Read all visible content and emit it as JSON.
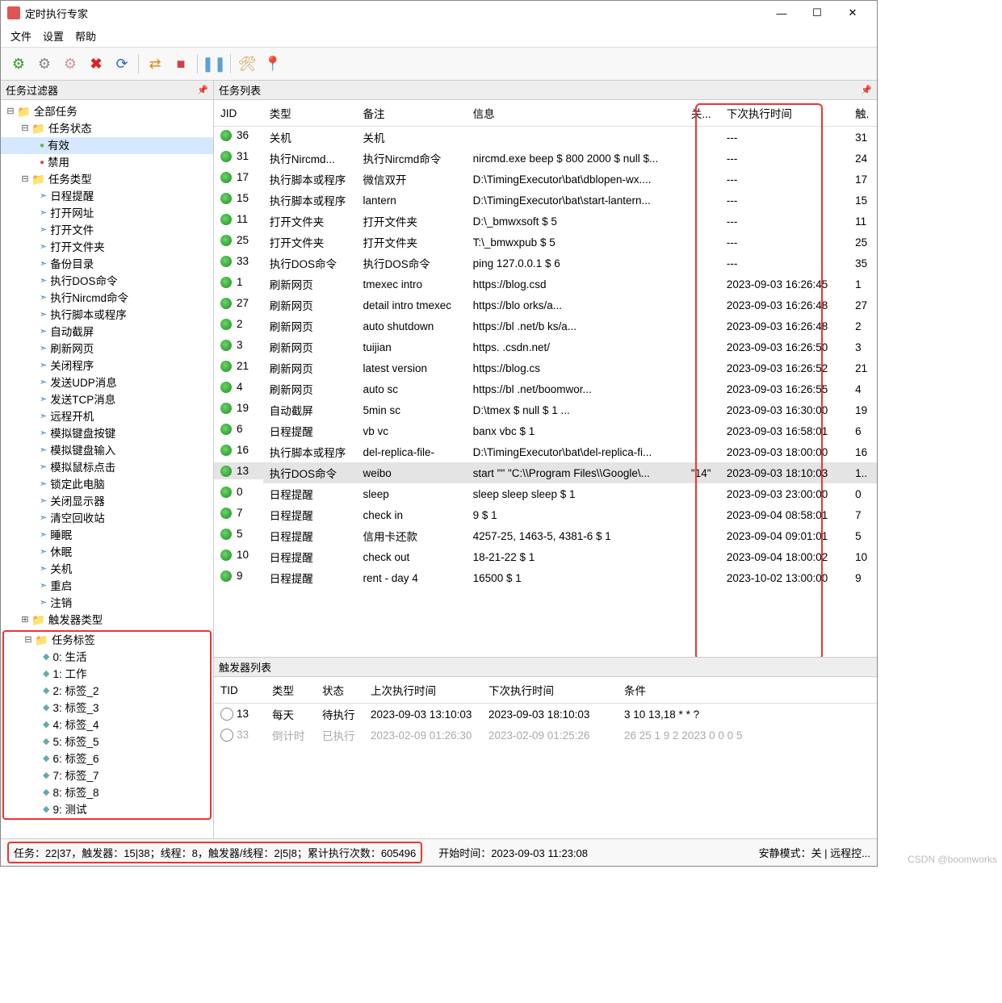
{
  "window": {
    "title": "定时执行专家"
  },
  "menubar": [
    "文件",
    "设置",
    "帮助"
  ],
  "sidebar": {
    "header": "任务过滤器",
    "root": "全部任务",
    "status": {
      "label": "任务状态",
      "items": [
        "有效",
        "禁用"
      ]
    },
    "taskTypes": {
      "label": "任务类型",
      "items": [
        "日程提醒",
        "打开网址",
        "打开文件",
        "打开文件夹",
        "备份目录",
        "执行DOS命令",
        "执行Nircmd命令",
        "执行脚本或程序",
        "自动截屏",
        "刷新网页",
        "关闭程序",
        "发送UDP消息",
        "发送TCP消息",
        "远程开机",
        "模拟键盘按键",
        "模拟键盘输入",
        "模拟鼠标点击",
        "锁定此电脑",
        "关闭显示器",
        "清空回收站",
        "睡眠",
        "休眠",
        "关机",
        "重启",
        "注销"
      ]
    },
    "triggerTypes": {
      "label": "触发器类型"
    },
    "tags": {
      "label": "任务标签",
      "items": [
        "0: 生活",
        "1: 工作",
        "2: 标签_2",
        "3: 标签_3",
        "4: 标签_4",
        "5: 标签_5",
        "6: 标签_6",
        "7: 标签_7",
        "8: 标签_8",
        "9: 测试"
      ]
    }
  },
  "taskList": {
    "header": "任务列表",
    "columns": [
      "JID",
      "类型",
      "备注",
      "信息",
      "关...",
      "下次执行时间",
      "触."
    ],
    "rows": [
      {
        "jid": "36",
        "type": "关机",
        "note": "关机",
        "info": "",
        "kw": "",
        "next": "---",
        "trg": "31"
      },
      {
        "jid": "31",
        "type": "执行Nircmd...",
        "note": "执行Nircmd命令",
        "info": "nircmd.exe beep $ 800 2000 $ null $...",
        "kw": "",
        "next": "---",
        "trg": "24"
      },
      {
        "jid": "17",
        "type": "执行脚本或程序",
        "note": "微信双开",
        "info": "D:\\TimingExecutor\\bat\\dblopen-wx....",
        "kw": "",
        "next": "---",
        "trg": "17"
      },
      {
        "jid": "15",
        "type": "执行脚本或程序",
        "note": "lantern",
        "info": "D:\\TimingExecutor\\bat\\start-lantern...",
        "kw": "",
        "next": "---",
        "trg": "15"
      },
      {
        "jid": "11",
        "type": "打开文件夹",
        "note": "打开文件夹",
        "info": "D:\\_bmwxsoft $ 5",
        "kw": "",
        "next": "---",
        "trg": "11"
      },
      {
        "jid": "25",
        "type": "打开文件夹",
        "note": "打开文件夹",
        "info": "T:\\_bmwxpub $ 5",
        "kw": "",
        "next": "---",
        "trg": "25"
      },
      {
        "jid": "33",
        "type": "执行DOS命令",
        "note": "执行DOS命令",
        "info": "ping 127.0.0.1 $ 6",
        "kw": "",
        "next": "---",
        "trg": "35"
      },
      {
        "jid": "1",
        "type": "刷新网页",
        "note": "tmexec intro",
        "info": "https://blog.csd",
        "kw": "",
        "next": "2023-09-03 16:26:45",
        "trg": "1"
      },
      {
        "jid": "27",
        "type": "刷新网页",
        "note": "detail intro tmexec",
        "info": "https://blo                         orks/a...",
        "kw": "",
        "next": "2023-09-03 16:26:48",
        "trg": "27"
      },
      {
        "jid": "2",
        "type": "刷新网页",
        "note": "auto shutdown",
        "info": "https://bl            .net/b           ks/a...",
        "kw": "",
        "next": "2023-09-03 16:26:48",
        "trg": "2"
      },
      {
        "jid": "3",
        "type": "刷新网页",
        "note": "tuijian",
        "info": "https.        .csdn.net/",
        "kw": "",
        "next": "2023-09-03 16:26:50",
        "trg": "3"
      },
      {
        "jid": "21",
        "type": "刷新网页",
        "note": "latest version",
        "info": "https://blog.cs",
        "kw": "",
        "next": "2023-09-03 16:26:52",
        "trg": "21"
      },
      {
        "jid": "4",
        "type": "刷新网页",
        "note": "auto sc",
        "info": "https://bl          .net/boomwor...",
        "kw": "",
        "next": "2023-09-03 16:26:55",
        "trg": "4"
      },
      {
        "jid": "19",
        "type": "自动截屏",
        "note": "5min sc",
        "info": "D:\\tmex      $ null $ 1            ...",
        "kw": "",
        "next": "2023-09-03 16:30:00",
        "trg": "19"
      },
      {
        "jid": "6",
        "type": "日程提醒",
        "note": "vb vc",
        "info": "banx vbc $ 1",
        "kw": "",
        "next": "2023-09-03 16:58:01",
        "trg": "6"
      },
      {
        "jid": "16",
        "type": "执行脚本或程序",
        "note": "del-replica-file-",
        "info": "D:\\TimingExecutor\\bat\\del-replica-fi...",
        "kw": "",
        "next": "2023-09-03 18:00:00",
        "trg": "16"
      },
      {
        "jid": "13",
        "type": "执行DOS命令",
        "note": "weibo",
        "info": "start \"\" \"C:\\\\Program Files\\\\Google\\...",
        "kw": "\"14\"",
        "next": "2023-09-03 18:10:03",
        "trg": "1..",
        "selected": true
      },
      {
        "jid": "0",
        "type": "日程提醒",
        "note": "sleep",
        "info": "sleep sleep sleep $ 1",
        "kw": "",
        "next": "2023-09-03 23:00:00",
        "trg": "0"
      },
      {
        "jid": "7",
        "type": "日程提醒",
        "note": "check in",
        "info": "9 $ 1",
        "kw": "",
        "next": "2023-09-04 08:58:01",
        "trg": "7"
      },
      {
        "jid": "5",
        "type": "日程提醒",
        "note": "信用卡还款",
        "info": "4257-25, 1463-5, 4381-6 $ 1",
        "kw": "",
        "next": "2023-09-04 09:01:01",
        "trg": "5"
      },
      {
        "jid": "10",
        "type": "日程提醒",
        "note": "check out",
        "info": "18-21-22 $ 1",
        "kw": "",
        "next": "2023-09-04 18:00:02",
        "trg": "10"
      },
      {
        "jid": "9",
        "type": "日程提醒",
        "note": "rent - day 4",
        "info": "16500 $ 1",
        "kw": "",
        "next": "2023-10-02 13:00:00",
        "trg": "9"
      }
    ]
  },
  "triggerList": {
    "header": "触发器列表",
    "columns": [
      "TID",
      "类型",
      "状态",
      "上次执行时间",
      "下次执行时间",
      "条件"
    ],
    "rows": [
      {
        "tid": "13",
        "type": "每天",
        "status": "待执行",
        "last": "2023-09-03 13:10:03",
        "next": "2023-09-03 18:10:03",
        "cond": "3 10 13,18 * * ?",
        "faded": false
      },
      {
        "tid": "33",
        "type": "倒计时",
        "status": "已执行",
        "last": "2023-02-09 01:26:30",
        "next": "2023-02-09 01:25:26",
        "cond": "26 25 1 9 2 2023 0 0 0 5",
        "faded": true
      }
    ]
  },
  "statusbar": {
    "left": "任务：22|37，触发器：15|38；线程：8，触发器/线程：2|5|8；累计执行次数：605496",
    "mid": "开始时间：2023-09-03 11:23:08",
    "right": "安静模式：关 | 远程控..."
  },
  "watermark": "CSDN @boomworks"
}
